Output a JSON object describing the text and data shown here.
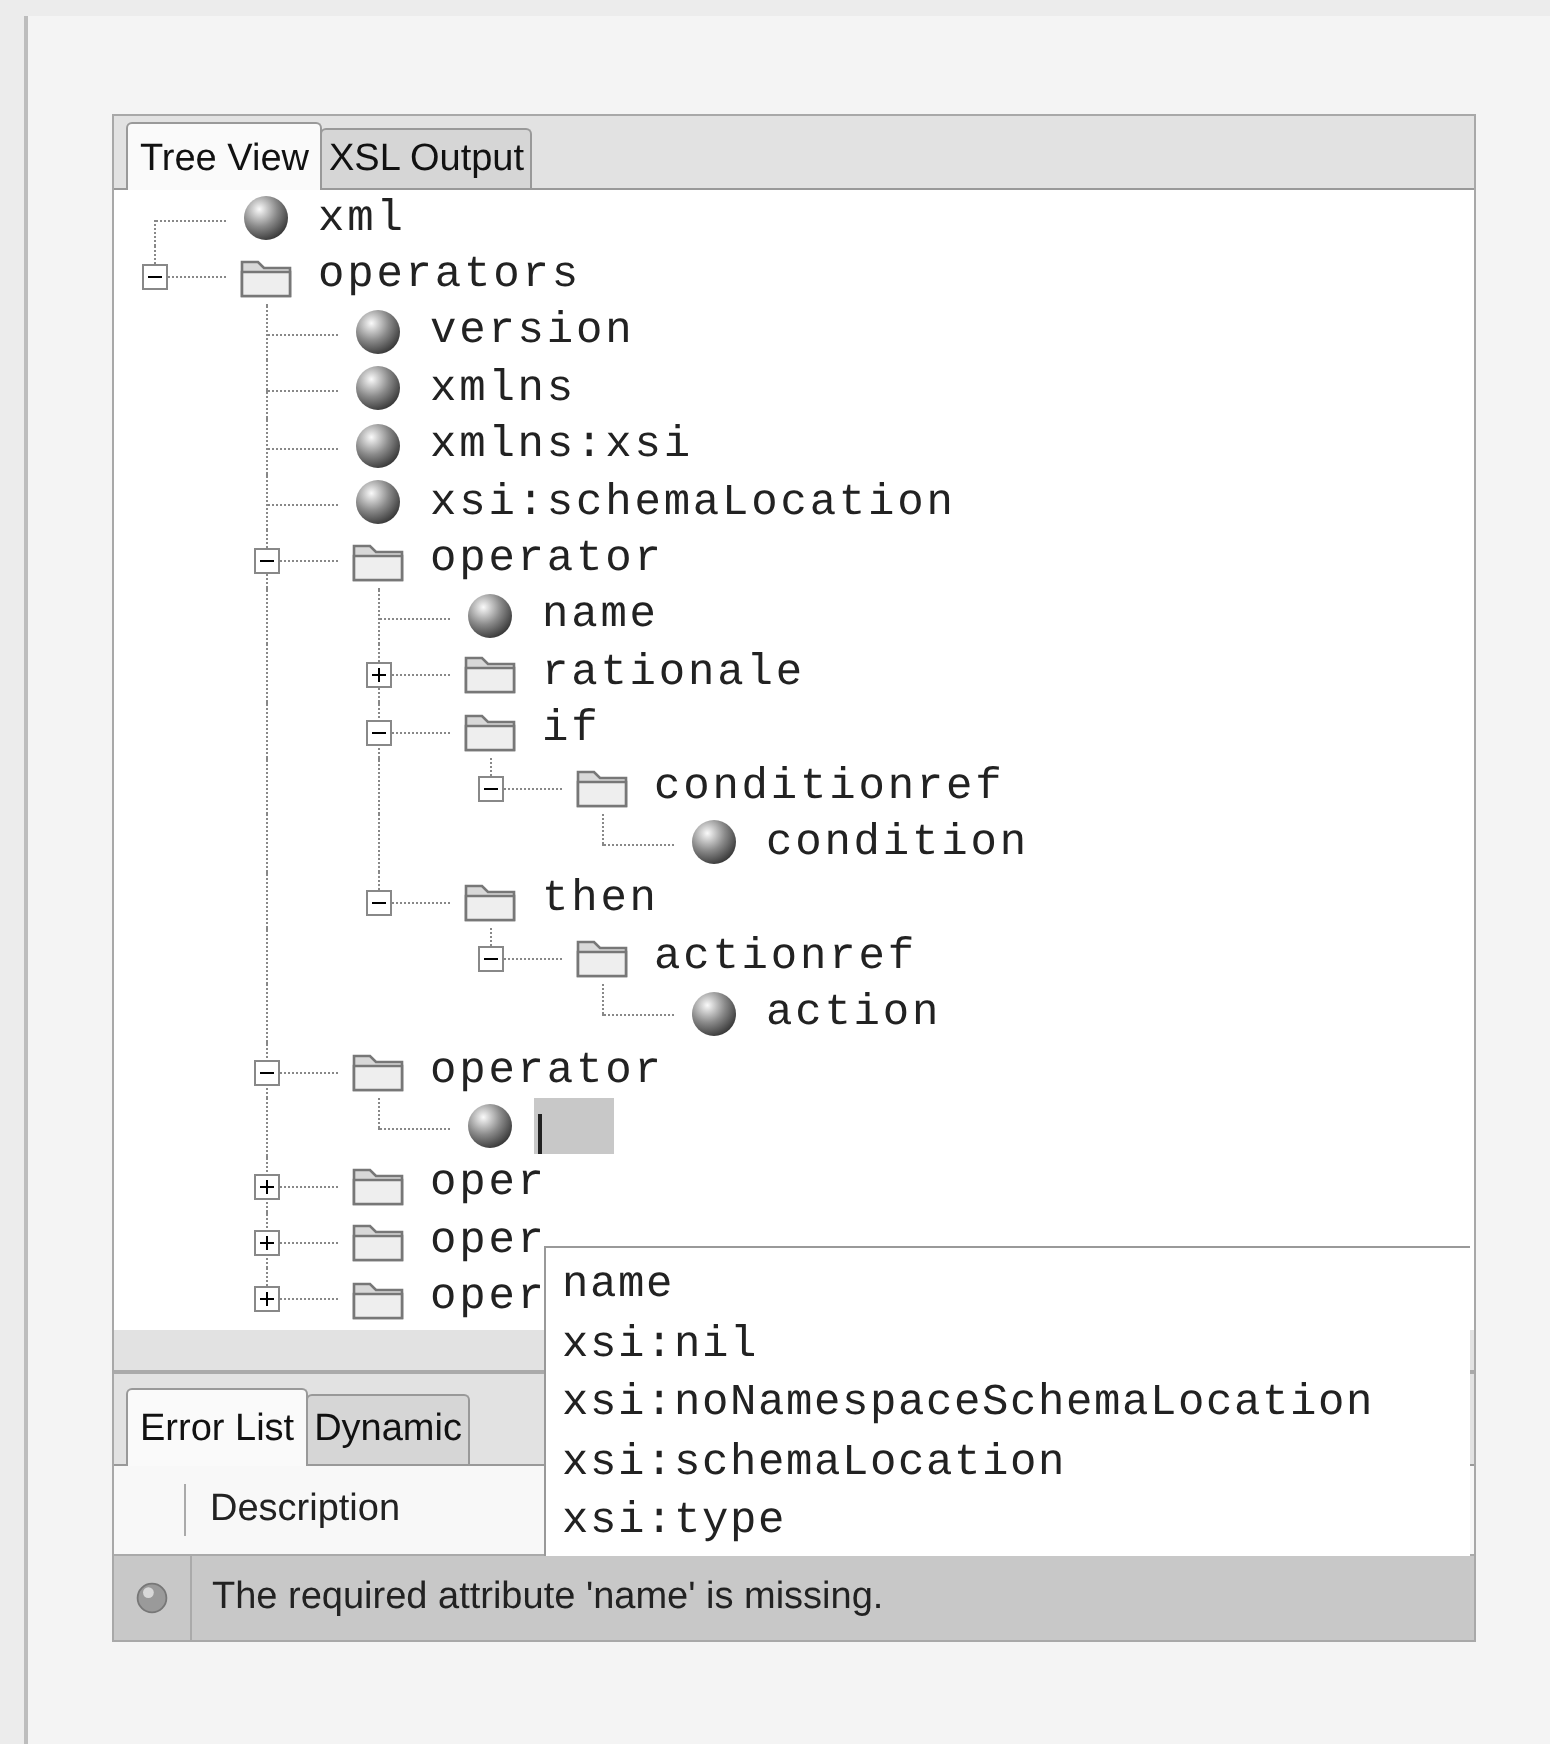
{
  "tabs": [
    {
      "label": "Tree View",
      "selected": true
    },
    {
      "label": "XSL Output",
      "selected": false
    }
  ],
  "tree": [
    {
      "kind": "attribute",
      "label": "xml"
    },
    {
      "kind": "element",
      "label": "operators",
      "expanded": true,
      "children": [
        {
          "kind": "attribute",
          "label": "version"
        },
        {
          "kind": "attribute",
          "label": "xmlns"
        },
        {
          "kind": "attribute",
          "label": "xmlns:xsi"
        },
        {
          "kind": "attribute",
          "label": "xsi:schemaLocation"
        },
        {
          "kind": "element",
          "label": "operator",
          "expanded": true,
          "children": [
            {
              "kind": "attribute",
              "label": "name"
            },
            {
              "kind": "element",
              "label": "rationale",
              "expanded": false
            },
            {
              "kind": "element",
              "label": "if",
              "expanded": true,
              "children": [
                {
                  "kind": "element",
                  "label": "conditionref",
                  "expanded": true,
                  "children": [
                    {
                      "kind": "attribute",
                      "label": "condition"
                    }
                  ]
                }
              ]
            },
            {
              "kind": "element",
              "label": "then",
              "expanded": true,
              "children": [
                {
                  "kind": "element",
                  "label": "actionref",
                  "expanded": true,
                  "children": [
                    {
                      "kind": "attribute",
                      "label": "action"
                    }
                  ]
                }
              ]
            }
          ]
        },
        {
          "kind": "element",
          "label": "operator",
          "expanded": true,
          "children": [
            {
              "kind": "edit"
            }
          ]
        },
        {
          "kind": "element",
          "label": "oper",
          "expanded": false
        },
        {
          "kind": "element",
          "label": "oper",
          "expanded": false
        },
        {
          "kind": "element",
          "label": "oper",
          "expanded": false
        }
      ]
    }
  ],
  "completion_list": {
    "items": [
      "name",
      "xsi:nil",
      "xsi:noNamespaceSchemaLocation",
      "xsi:schemaLocation",
      "xsi:type"
    ]
  },
  "bottom_tabs": [
    {
      "label": "Error List",
      "selected": true
    },
    {
      "label": "Dynamic",
      "selected": false
    }
  ],
  "error_table": {
    "columns": [
      "Description"
    ],
    "rows": [
      {
        "description": "The required attribute 'name' is missing."
      }
    ]
  }
}
